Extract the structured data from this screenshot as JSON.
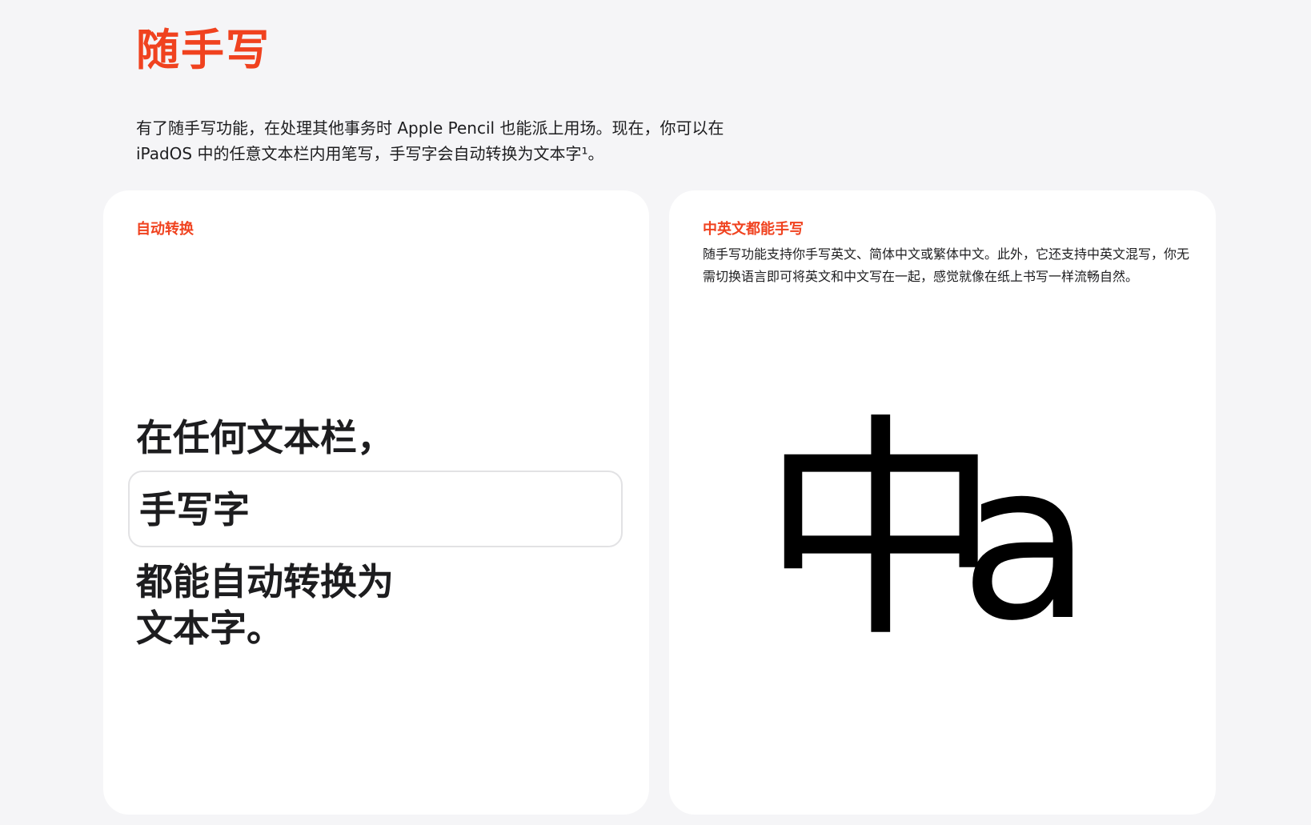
{
  "header": {
    "title": "随手写",
    "intro": "有了随手写功能，在处理其他事务时 Apple Pencil 也能派上用场。现在，你可以在 iPadOS 中的任意文本栏内用笔写，手写字会自动转换为文本字¹。"
  },
  "card_left": {
    "eyebrow": "自动转换",
    "line1": "在任何文本栏，",
    "input_text": "手写字",
    "line3": "都能自动转换为",
    "line4": "文本字。"
  },
  "card_right": {
    "eyebrow": "中英文都能手写",
    "description": "随手写功能支持你手写英文、简体中文或繁体中文。此外，它还支持中英文混写，你无需切换语言即可将英文和中文写在一起，感觉就像在纸上书写一样流畅自然。",
    "glyph_cn": "中",
    "glyph_en": "a"
  },
  "colors": {
    "accent": "#f0421f",
    "background": "#f5f5f7",
    "card": "#ffffff",
    "text": "#1d1d1f"
  }
}
